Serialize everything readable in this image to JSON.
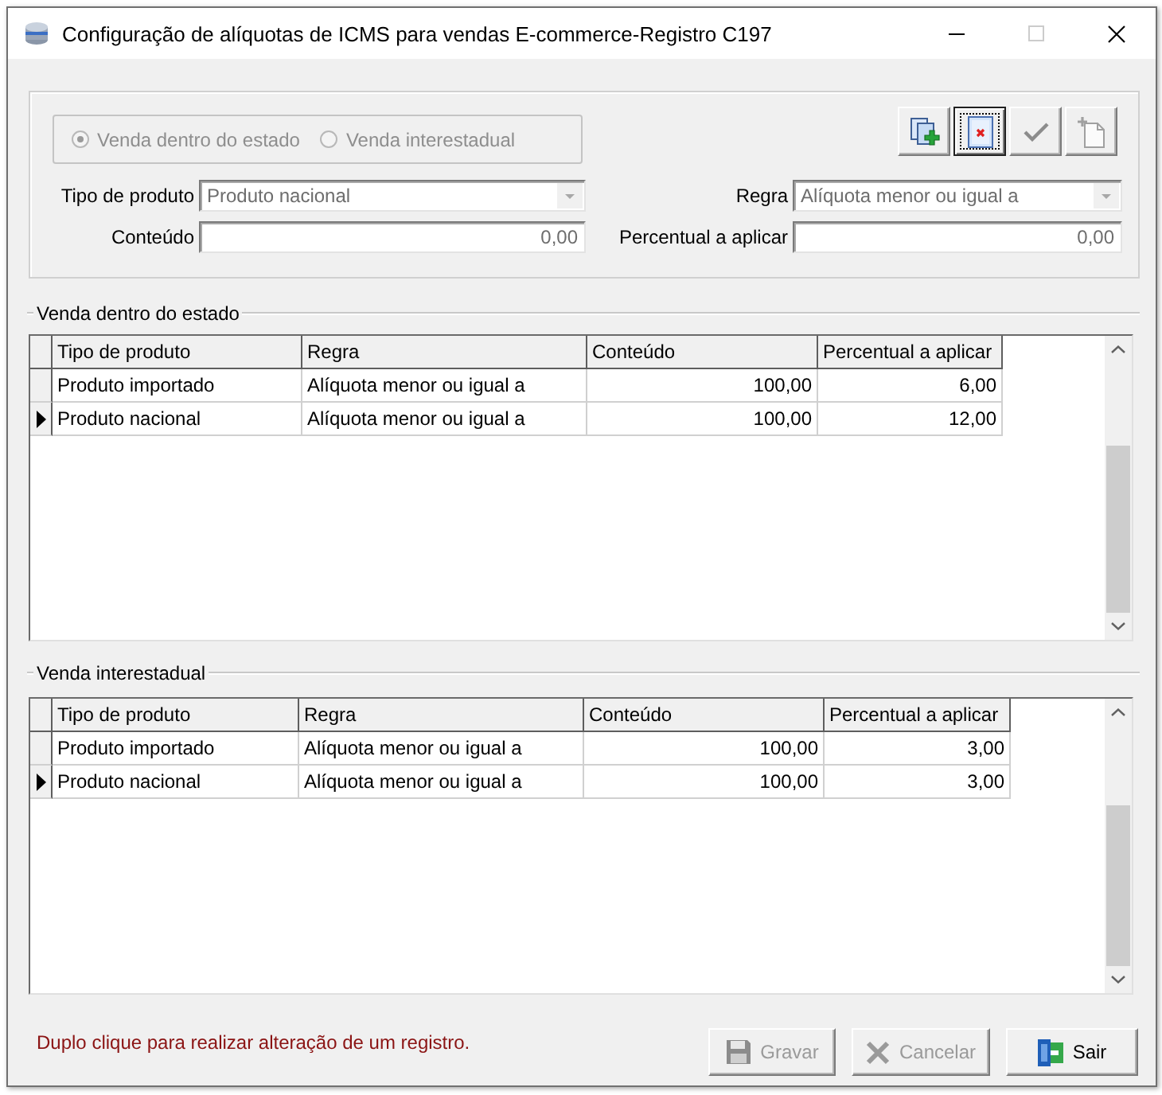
{
  "window": {
    "title": "Configuração de alíquotas de ICMS para vendas E-commerce-Registro C197",
    "maximize_disabled": true
  },
  "sale_type": {
    "disabled": true,
    "options": [
      {
        "label": "Venda dentro do estado",
        "selected": true
      },
      {
        "label": "Venda interestadual",
        "selected": false
      }
    ]
  },
  "toolbar": [
    {
      "kind": "add",
      "disabled": false,
      "focused": false
    },
    {
      "kind": "delete",
      "disabled": false,
      "focused": true
    },
    {
      "kind": "confirm",
      "disabled": true,
      "focused": false
    },
    {
      "kind": "new",
      "disabled": true,
      "focused": false
    }
  ],
  "form": {
    "fields": [
      {
        "label": "Tipo de produto",
        "kind": "combo",
        "value": "Produto nacional",
        "disabled": true
      },
      {
        "label": "Regra",
        "kind": "combo",
        "value": "Alíquota menor ou igual a",
        "disabled": true
      },
      {
        "label": "Conteúdo",
        "kind": "number",
        "value": "0,00",
        "disabled": true
      },
      {
        "label": "Percentual a aplicar",
        "kind": "number",
        "value": "0,00",
        "disabled": true
      }
    ]
  },
  "grids": [
    {
      "title": "Venda dentro do estado",
      "columns": [
        "Tipo de produto",
        "Regra",
        "Conteúdo",
        "Percentual a aplicar"
      ],
      "rows": [
        {
          "cells": [
            "Produto importado",
            "Alíquota menor ou igual a",
            "100,00",
            "6,00"
          ],
          "selected": false
        },
        {
          "cells": [
            "Produto nacional",
            "Alíquota menor ou igual a",
            "100,00",
            "12,00"
          ],
          "selected": true
        }
      ]
    },
    {
      "title": "Venda interestadual",
      "columns": [
        "Tipo de produto",
        "Regra",
        "Conteúdo",
        "Percentual a aplicar"
      ],
      "rows": [
        {
          "cells": [
            "Produto importado",
            "Alíquota menor ou igual a",
            "100,00",
            "3,00"
          ],
          "selected": false
        },
        {
          "cells": [
            "Produto nacional",
            "Alíquota menor ou igual a",
            "100,00",
            "3,00"
          ],
          "selected": true
        }
      ]
    }
  ],
  "message": "Duplo clique para realizar alteração de um registro.",
  "buttons": [
    {
      "label": "Gravar",
      "kind": "save",
      "disabled": true
    },
    {
      "label": "Cancelar",
      "kind": "cancel",
      "disabled": true
    },
    {
      "label": "Sair",
      "kind": "exit",
      "disabled": false
    }
  ]
}
